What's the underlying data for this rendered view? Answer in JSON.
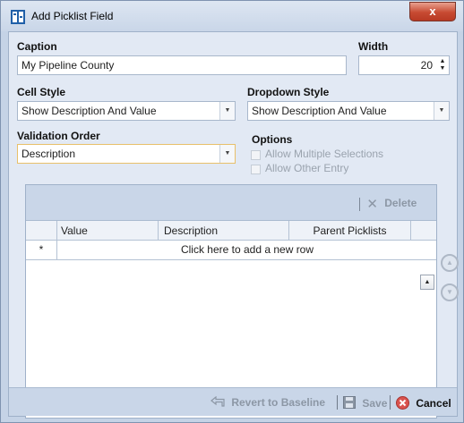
{
  "window": {
    "title": "Add Picklist Field",
    "close_glyph": "x"
  },
  "caption": {
    "label": "Caption",
    "value": "My Pipeline County"
  },
  "width": {
    "label": "Width",
    "value": "20"
  },
  "cell_style": {
    "label": "Cell Style",
    "value": "Show Description And Value"
  },
  "dropdown_style": {
    "label": "Dropdown Style",
    "value": "Show Description And Value"
  },
  "validation_order": {
    "label": "Validation Order",
    "value": "Description"
  },
  "options": {
    "label": "Options",
    "allow_multiple": "Allow Multiple Selections",
    "allow_other": "Allow Other Entry"
  },
  "grid": {
    "delete_label": "Delete",
    "columns": [
      "Value",
      "Description",
      "Parent Picklists"
    ],
    "new_row_indicator": "*",
    "new_row_text": "Click here to add a new row"
  },
  "footer": {
    "revert_label": "Revert to Baseline",
    "save_label": "Save",
    "cancel_label": "Cancel"
  },
  "colors": {
    "window_bg": "#c5d3e6",
    "client_bg": "#e2e9f4",
    "close_red": "#c74a32",
    "cancel_red": "#d9534f",
    "focus_border": "#e8c06a"
  },
  "icons": {
    "title": "picklist-icon",
    "delete": "x-icon",
    "revert": "revert-arrow-icon",
    "save": "floppy-disk-icon",
    "cancel": "cancel-circle-icon",
    "move_up": "circle-up-icon",
    "move_down": "circle-down-icon"
  }
}
